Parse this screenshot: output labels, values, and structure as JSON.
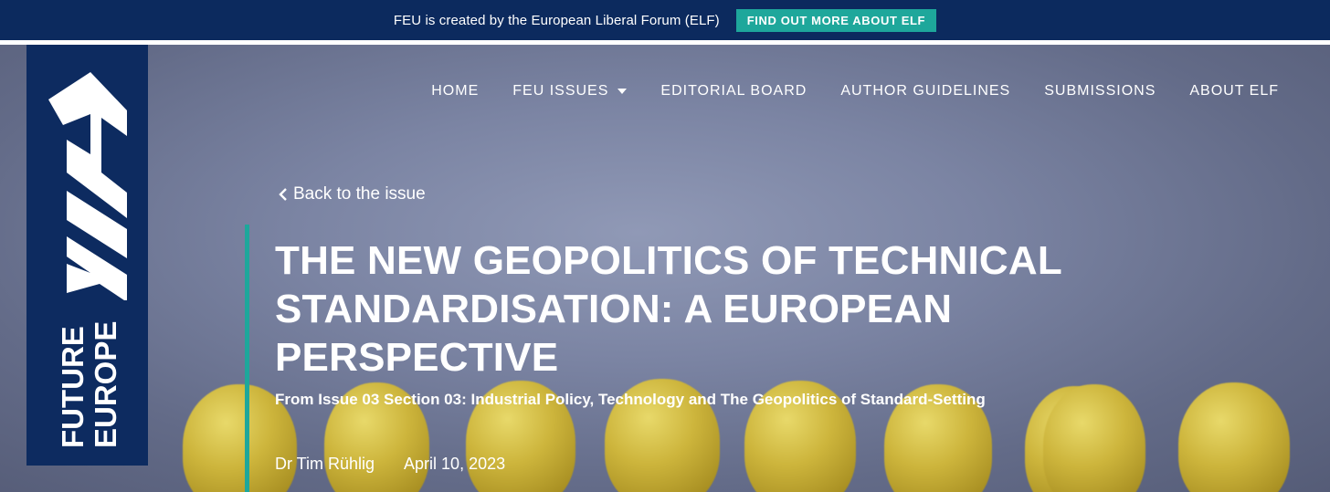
{
  "topbar": {
    "text": "FEU is created by the European Liberal Forum (ELF)",
    "button": "FIND OUT MORE ABOUT ELF"
  },
  "logo": {
    "line1": "FUTURE",
    "line2": "EUROPE",
    "mark_icon": "feu-logo-mark-icon"
  },
  "nav": {
    "items": [
      {
        "label": "HOME"
      },
      {
        "label": "FEU ISSUES",
        "icon": "chevron-down-icon"
      },
      {
        "label": "EDITORIAL BOARD"
      },
      {
        "label": "AUTHOR GUIDELINES"
      },
      {
        "label": "SUBMISSIONS"
      },
      {
        "label": "ABOUT ELF"
      }
    ]
  },
  "article": {
    "back_label": "Back to the issue",
    "title": "THE NEW GEOPOLITICS OF TECHNICAL STANDARDISATION: A EUROPEAN PERSPECTIVE",
    "subtitle": "From Issue 03 Section 03: Industrial Policy, Technology and The Geopolitics of Standard-Setting",
    "author": "Dr Tim Rühlig",
    "date": "April 10, 2023"
  },
  "colors": {
    "navy": "#0c2a5e",
    "teal": "#1ea79b",
    "hero_gray": "#7b84a3",
    "bulb_yellow": "#cdb53c"
  }
}
